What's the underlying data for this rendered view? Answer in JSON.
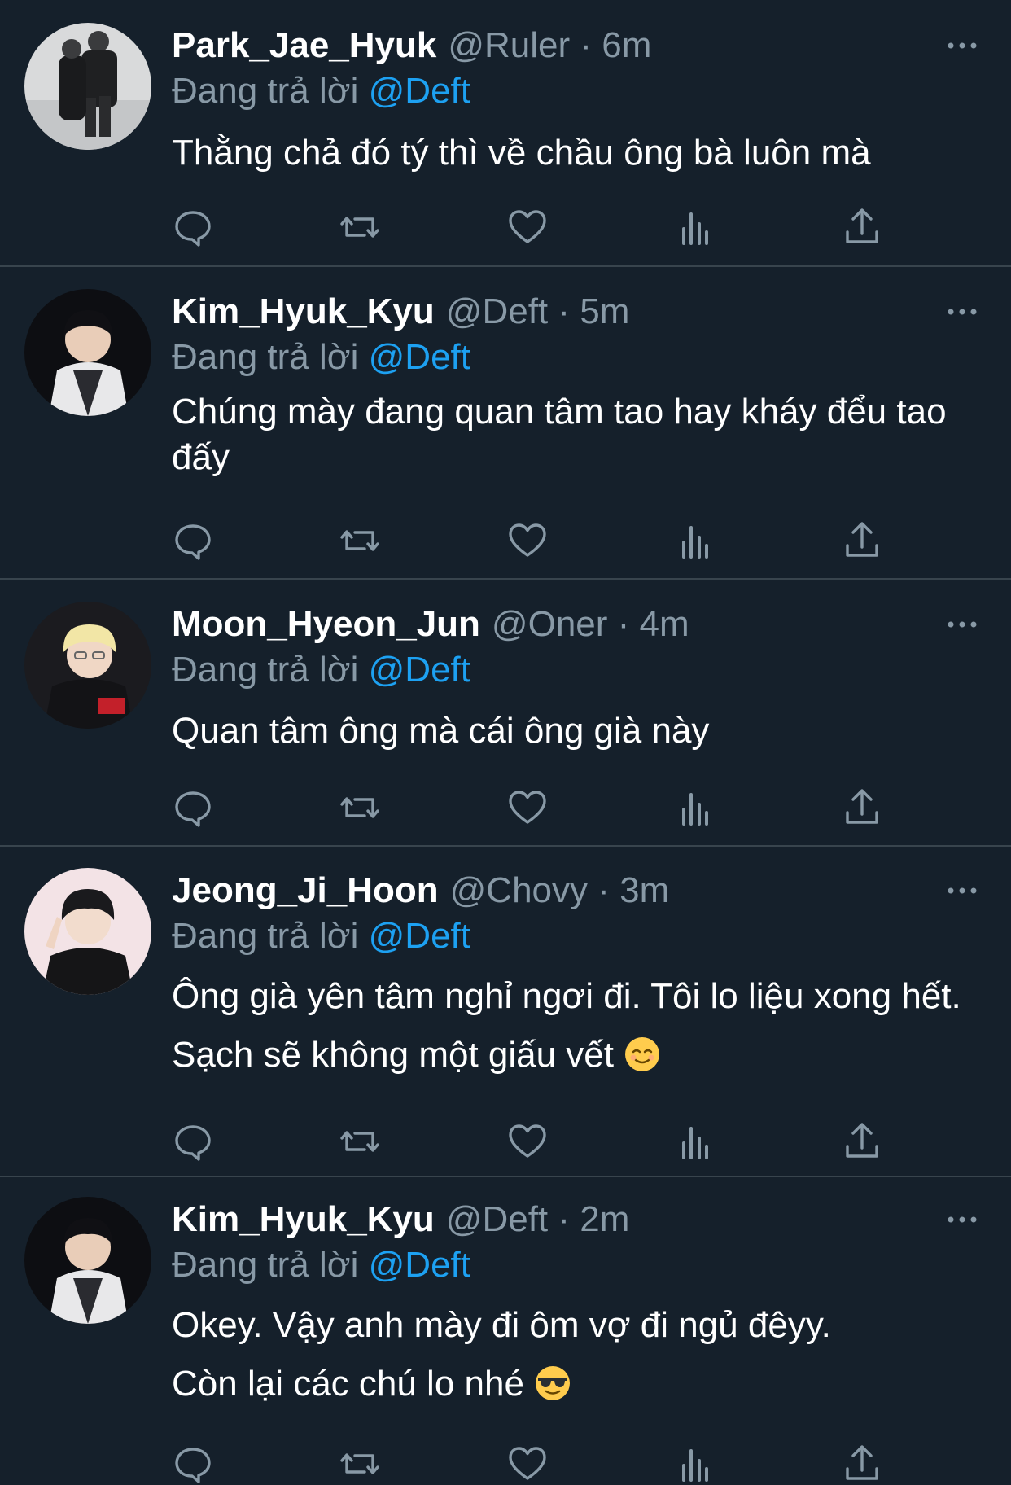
{
  "reply_prefix": "Đang trả lời",
  "tweets": [
    {
      "display_name": "Park_Jae_Hyuk",
      "handle": "@Ruler",
      "time": "6m",
      "reply_to": "@Deft",
      "text": "Thằng chả đó tý thì về chầu ông bà luôn mà"
    },
    {
      "display_name": "Kim_Hyuk_Kyu",
      "handle": "@Deft",
      "time": "5m",
      "reply_to": "@Deft",
      "text": "Chúng mày đang quan tâm tao hay kháy đểu tao đấy"
    },
    {
      "display_name": "Moon_Hyeon_Jun",
      "handle": "@Oner",
      "time": "4m",
      "reply_to": "@Deft",
      "text": "Quan tâm ông mà cái ông già này"
    },
    {
      "display_name": "Jeong_Ji_Hoon",
      "handle": "@Chovy",
      "time": "3m",
      "reply_to": "@Deft",
      "text": "Ông già yên tâm nghỉ ngơi đi. Tôi lo liệu xong hết. Sạch sẽ không một giấu vết"
    },
    {
      "display_name": "Kim_Hyuk_Kyu",
      "handle": "@Deft",
      "time": "2m",
      "reply_to": "@Deft",
      "text_line1": "Okey. Vậy anh mày đi ôm vợ đi ngủ đêyy.",
      "text_line2": "Còn lại các chú lo nhé"
    }
  ],
  "separator": "·",
  "icons": [
    "more-icon",
    "reply-icon",
    "retweet-icon",
    "like-icon",
    "analytics-icon",
    "share-icon",
    "relieved-face-emoji",
    "sunglasses-face-emoji"
  ],
  "colors": {
    "background": "#15202b",
    "divider": "#38444d",
    "secondary_text": "#8899a6",
    "mention": "#1da1f2"
  }
}
